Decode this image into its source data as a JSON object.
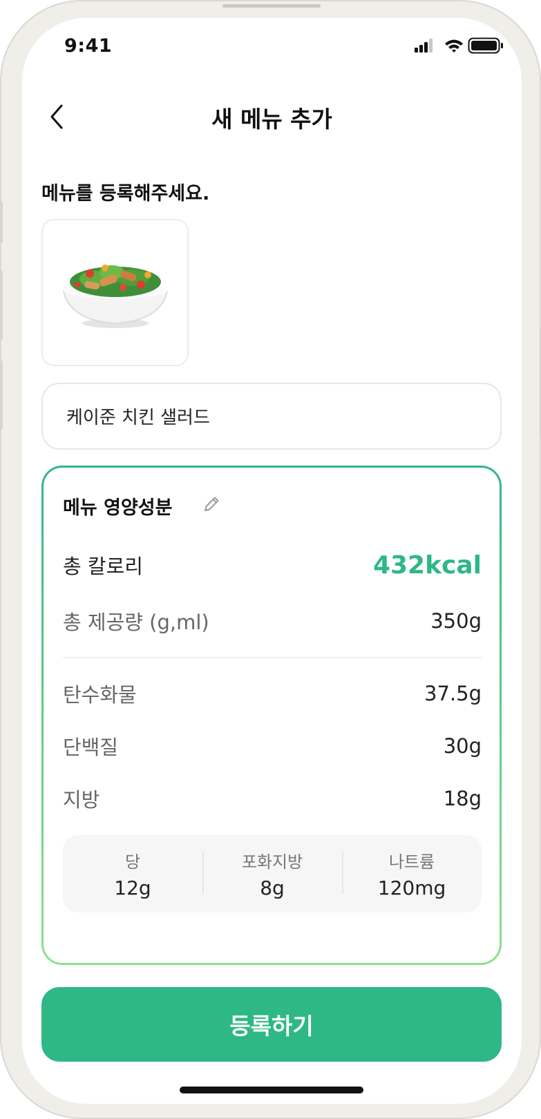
{
  "status_bar": {
    "time": "9:41"
  },
  "header": {
    "title": "새 메뉴 추가"
  },
  "form": {
    "section_title": "메뉴를 등록해주세요.",
    "menu_name_value": "케이준 치킨 샐러드"
  },
  "nutrition": {
    "title": "메뉴 영양성분",
    "calorie": {
      "label": "총 칼로리",
      "value": "432kcal"
    },
    "serving": {
      "label": "총 제공량 (g,ml)",
      "value": "350g"
    },
    "macros": [
      {
        "label": "탄수화물",
        "value": "37.5g"
      },
      {
        "label": "단백질",
        "value": "30g"
      },
      {
        "label": "지방",
        "value": "18g"
      }
    ],
    "sub": [
      {
        "label": "당",
        "value": "12g"
      },
      {
        "label": "포화지방",
        "value": "8g"
      },
      {
        "label": "나트륨",
        "value": "120mg"
      }
    ]
  },
  "submit_label": "등록하기",
  "colors": {
    "accent": "#2db886",
    "card_gradient_end": "#8ee08c"
  }
}
